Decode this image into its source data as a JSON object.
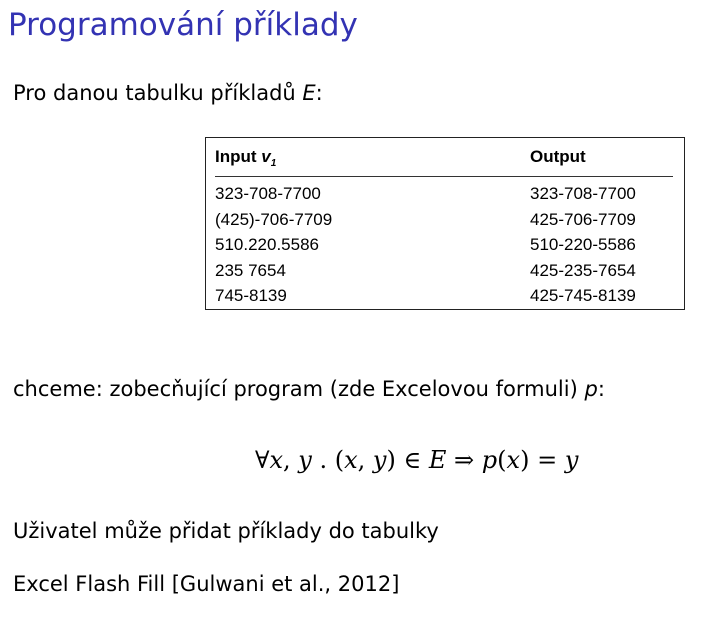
{
  "slide": {
    "title": "Programování příklady"
  },
  "intro": {
    "text": "Pro danou tabulku příkladů ",
    "var": "E",
    "suffix": ":"
  },
  "table": {
    "header_input": "Input ",
    "header_input_var": "v",
    "header_input_sub": "1",
    "header_output": "Output",
    "rows": [
      {
        "input": "323-708-7700",
        "output": "323-708-7700"
      },
      {
        "input": "(425)-706-7709",
        "output": "425-706-7709"
      },
      {
        "input": "510.220.5586",
        "output": "510-220-5586"
      },
      {
        "input": "235 7654",
        "output": "425-235-7654"
      },
      {
        "input": "745-8139",
        "output": "425-745-8139"
      }
    ]
  },
  "want": {
    "text": "chceme: zobecňující program (zde Excelovou formuli) ",
    "var": "p",
    "suffix": ":"
  },
  "formula": {
    "forall": "∀",
    "x1": "x",
    "comma1": ", ",
    "y1": "y",
    "dot": " . (",
    "x2": "x",
    "comma2": ", ",
    "y2": "y",
    "in": ") ∈ ",
    "E": "E",
    "implies": " ⇒ ",
    "p": "p",
    "open": "(",
    "x3": "x",
    "eq": ") = ",
    "y3": "y"
  },
  "user_note": "Uživatel může přidat příklady do tabulky",
  "reference": "Excel Flash Fill [Gulwani et al., 2012]"
}
